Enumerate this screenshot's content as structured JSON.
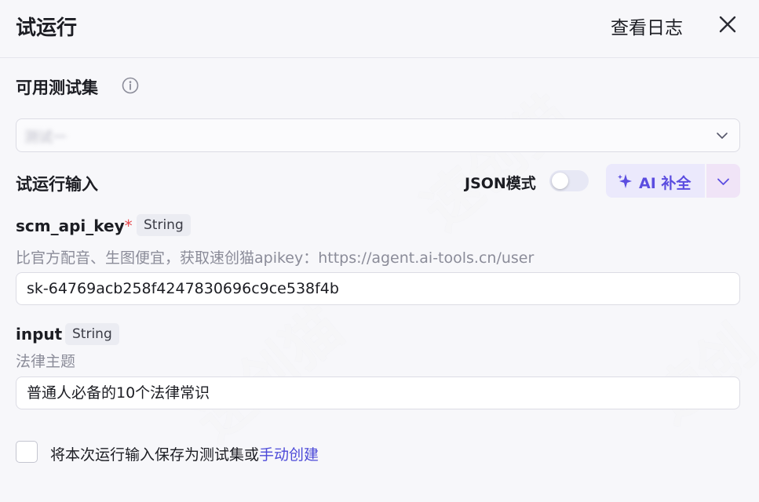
{
  "header": {
    "title": "试运行",
    "view_log": "查看日志"
  },
  "test_sets": {
    "label": "可用测试集",
    "selected_value": "测试一"
  },
  "run_input": {
    "label": "试运行输入",
    "json_mode_label": "JSON模式",
    "json_mode_on": false,
    "ai_complete_label": "AI 补全"
  },
  "fields": [
    {
      "name": "scm_api_key",
      "required_mark": "*",
      "type": "String",
      "description": "比官方配音、生图便宜，获取速创猫apikey：https://agent.ai-tools.cn/user",
      "value": "sk-64769acb258f4247830696c9ce538f4b"
    },
    {
      "name": "input",
      "type": "String",
      "description": "法律主题",
      "value": "普通人必备的10个法律常识"
    }
  ],
  "save_option": {
    "text": "将本次运行输入保存为测试集或",
    "link": "手动创建",
    "checked": false
  },
  "colors": {
    "accent": "#5b4de0",
    "link": "#4c4ad8",
    "required": "#e5484d"
  }
}
